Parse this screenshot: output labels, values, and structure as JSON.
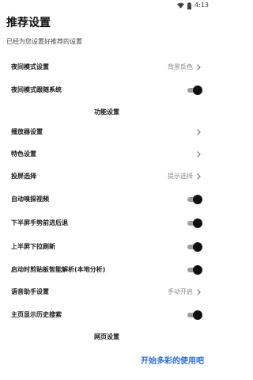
{
  "status_bar": {
    "time": "4:13",
    "icons": [
      "wifi-icon",
      "battery-icon"
    ]
  },
  "header": {
    "title": "推荐设置",
    "subtitle": "已经为您设置好推荐的设置"
  },
  "settings": {
    "night_mode": {
      "label": "夜间模式设置",
      "value": "背景反色"
    },
    "night_follow_system": {
      "label": "夜间模式跟随系统",
      "enabled": true
    },
    "section_function": "功能设置",
    "player": {
      "label": "播放器设置"
    },
    "features": {
      "label": "特色设置"
    },
    "cast": {
      "label": "投屏选择",
      "value": "提示选择"
    },
    "auto_sniff": {
      "label": "自动嗅探视频",
      "enabled": true
    },
    "gesture_back": {
      "label": "下半屏手势前进后退",
      "enabled": true
    },
    "pull_refresh": {
      "label": "上半屏下拉刷新",
      "enabled": true
    },
    "clipboard": {
      "label": "启动时剪贴板智能解析(本地分析)",
      "enabled": true
    },
    "voice": {
      "label": "语音助手设置",
      "value": "手动开启"
    },
    "history": {
      "label": "主页显示历史搜索",
      "enabled": true
    },
    "section_web": "网页设置"
  },
  "cta": {
    "label": "开始多彩的使用吧"
  },
  "colors": {
    "accent": "#2f6ed6",
    "toggle_knob": "#111111",
    "toggle_track": "#9e9e9e"
  }
}
